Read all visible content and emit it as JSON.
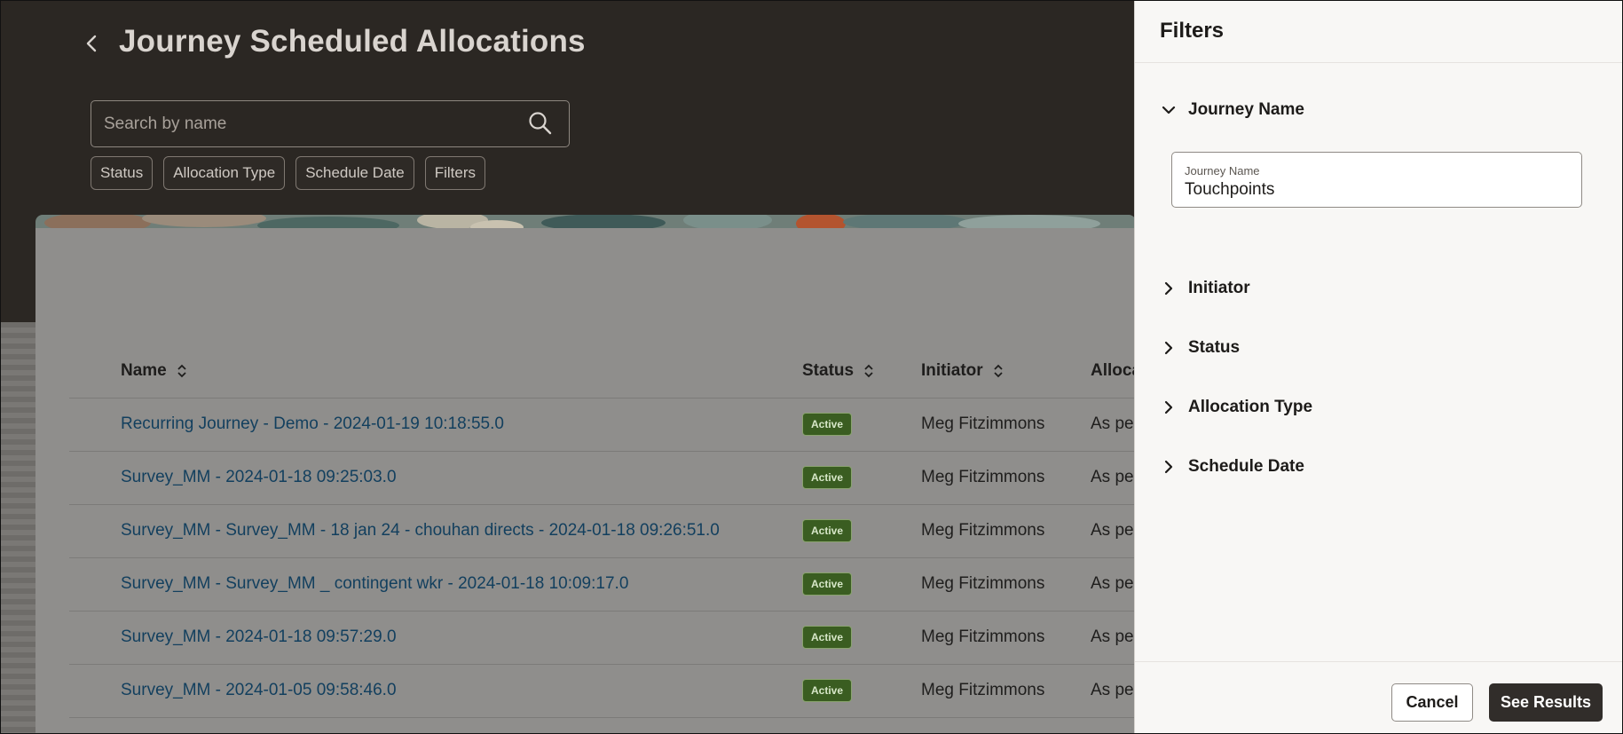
{
  "page": {
    "title": "Journey Scheduled Allocations",
    "search_placeholder": "Search by name",
    "chips": [
      "Status",
      "Allocation Type",
      "Schedule Date",
      "Filters"
    ]
  },
  "table": {
    "columns": {
      "name": "Name",
      "status": "Status",
      "initiator": "Initiator",
      "allocation": "Alloca"
    },
    "rows": [
      {
        "name": "Recurring Journey - Demo - 2024-01-19 10:18:55.0",
        "status": "Active",
        "initiator": "Meg Fitzimmons",
        "allocation": "As pe"
      },
      {
        "name": "Survey_MM - 2024-01-18 09:25:03.0",
        "status": "Active",
        "initiator": "Meg Fitzimmons",
        "allocation": "As pe"
      },
      {
        "name": "Survey_MM - Survey_MM - 18 jan 24 - chouhan directs - 2024-01-18 09:26:51.0",
        "status": "Active",
        "initiator": "Meg Fitzimmons",
        "allocation": "As pe"
      },
      {
        "name": "Survey_MM - Survey_MM _ contingent wkr - 2024-01-18 10:09:17.0",
        "status": "Active",
        "initiator": "Meg Fitzimmons",
        "allocation": "As pe"
      },
      {
        "name": "Survey_MM - 2024-01-18 09:57:29.0",
        "status": "Active",
        "initiator": "Meg Fitzimmons",
        "allocation": "As pe"
      },
      {
        "name": "Survey_MM - 2024-01-05 09:58:46.0",
        "status": "Active",
        "initiator": "Meg Fitzimmons",
        "allocation": "As pe"
      }
    ]
  },
  "drawer": {
    "title": "Filters",
    "sections": {
      "journey_name": "Journey Name",
      "initiator": "Initiator",
      "status": "Status",
      "allocation_type": "Allocation Type",
      "schedule_date": "Schedule Date"
    },
    "journey_field": {
      "label": "Journey Name",
      "value": "Touchpoints"
    },
    "cancel_label": "Cancel",
    "results_label": "See Results"
  },
  "colors": {
    "header_bg": "#2b2723",
    "link": "#123f5e",
    "badge_bg": "#3a5d21",
    "primary_button": "#312d2a"
  },
  "icons": [
    "chevron-left-icon",
    "search-icon",
    "sort-icon",
    "chevron-down-icon",
    "chevron-right-icon"
  ]
}
